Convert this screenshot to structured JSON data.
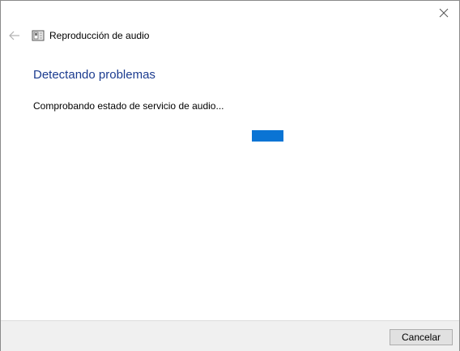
{
  "window": {
    "title": "Reproducción de audio"
  },
  "main": {
    "heading": "Detectando problemas",
    "status": "Comprobando estado de servicio de audio...",
    "progress_color": "#0a74d4"
  },
  "footer": {
    "cancel_label": "Cancelar"
  },
  "colors": {
    "heading": "#1b3b8f",
    "footer_bg": "#f0f0f0"
  },
  "icons": [
    "close-icon",
    "back-arrow-icon",
    "audio-troubleshooter-icon"
  ]
}
